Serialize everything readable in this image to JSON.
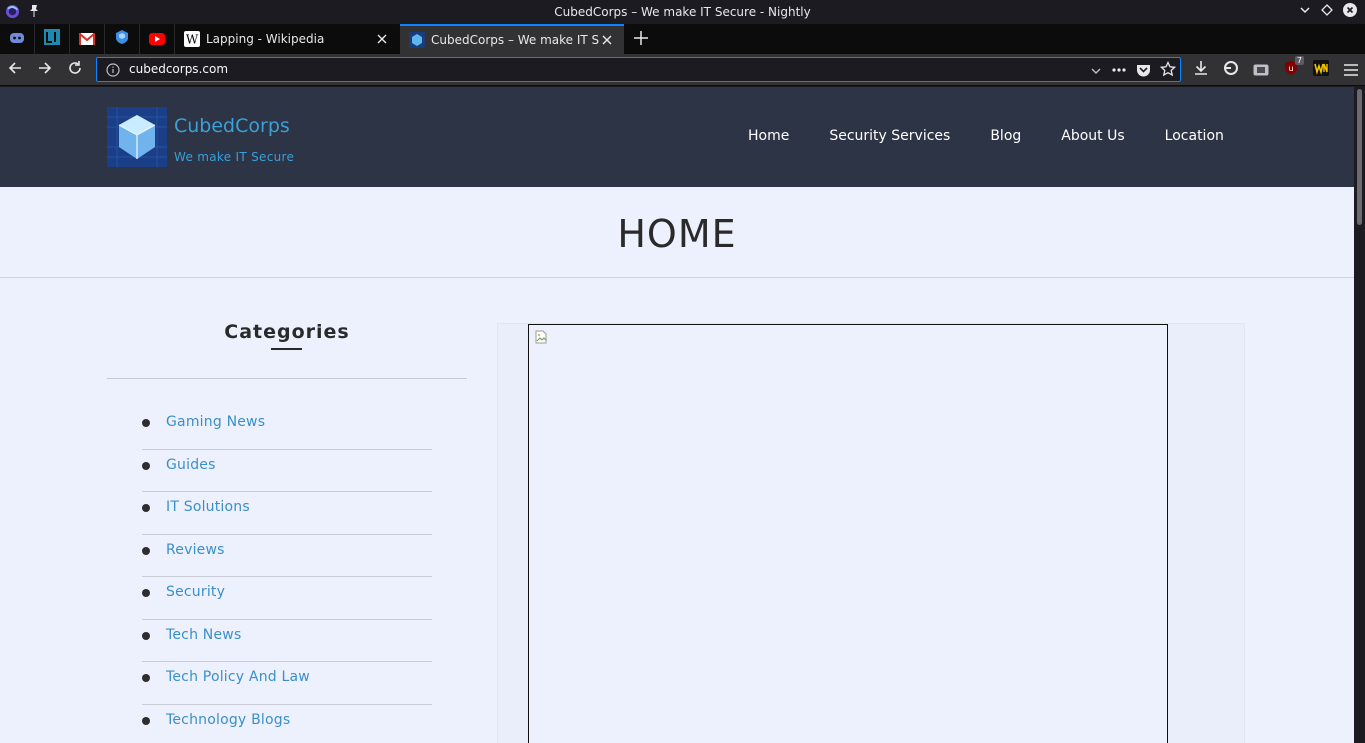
{
  "window": {
    "title": "CubedCorps – We make IT Secure - Nightly"
  },
  "tabs": [
    {
      "label": "Lapping - Wikipedia",
      "favicon": "wikipedia-icon",
      "active": false
    },
    {
      "label": "CubedCorps – We make IT Secure",
      "favicon": "cubedcorps-icon",
      "active": true
    }
  ],
  "pinned_tabs": [
    "discord-icon",
    "l1-icon",
    "gmail-icon",
    "shield-icon",
    "youtube-icon"
  ],
  "urlbar": {
    "url": "cubedcorps.com",
    "extension_badge": "7"
  },
  "site": {
    "brand": "CubedCorps",
    "tagline": "We make IT Secure",
    "nav": [
      "Home",
      "Security Services",
      "Blog",
      "About Us",
      "Location"
    ],
    "page_title": "HOME"
  },
  "sidebar": {
    "heading": "Categories",
    "categories": [
      "Gaming News",
      "Guides",
      "IT Solutions",
      "Reviews",
      "Security",
      "Tech News",
      "Tech Policy And Law",
      "Technology Blogs"
    ]
  },
  "colors": {
    "header_bg": "#2d3446",
    "accent": "#3aa0d8",
    "page_bg": "#edf1fe",
    "chrome_active_tab": "#0a84ff"
  }
}
